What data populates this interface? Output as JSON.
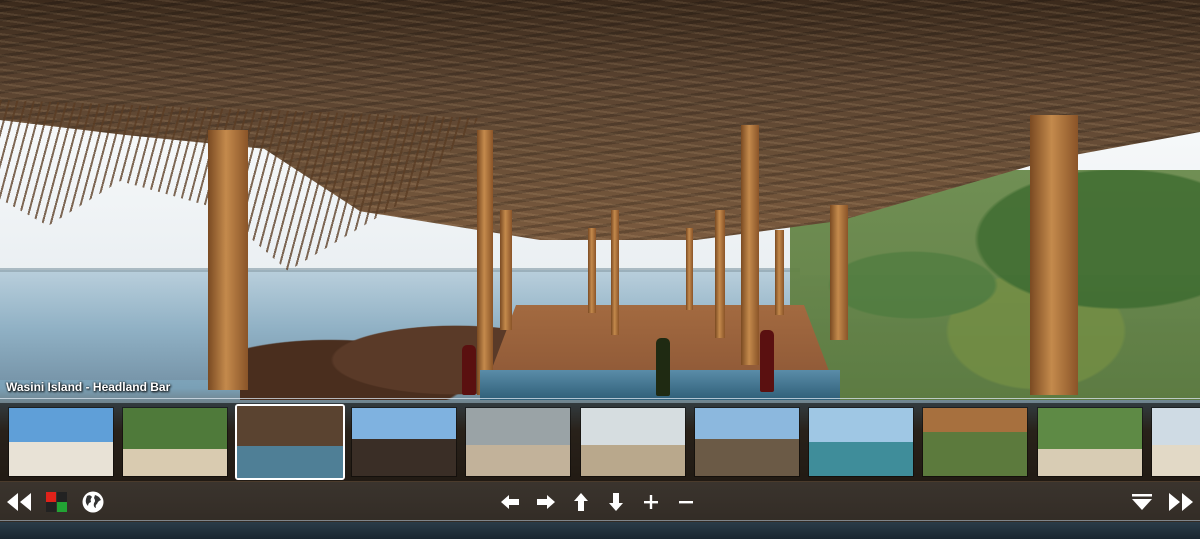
{
  "caption": "Wasini Island - Headland Bar",
  "thumbnails": [
    {
      "sky": "#5f9fd8",
      "ground": "#e8e2d6",
      "split": 0.5
    },
    {
      "sky": "#4f7a3a",
      "ground": "#d9cbb0",
      "split": 0.6
    },
    {
      "sky": "#5a4330",
      "ground": "#4f7f96",
      "split": 0.55,
      "selected": true
    },
    {
      "sky": "#7fb2e0",
      "ground": "#3a2e26",
      "split": 0.45
    },
    {
      "sky": "#9aa3a6",
      "ground": "#c2b29a",
      "split": 0.55
    },
    {
      "sky": "#d6dde0",
      "ground": "#b9a88c",
      "split": 0.55
    },
    {
      "sky": "#8cb8de",
      "ground": "#6b5a46",
      "split": 0.45
    },
    {
      "sky": "#9fc7e4",
      "ground": "#3f8d9a",
      "split": 0.5
    },
    {
      "sky": "#a7703e",
      "ground": "#5c7a3d",
      "split": 0.35
    },
    {
      "sky": "#5e8a45",
      "ground": "#d8ccb4",
      "split": 0.6
    },
    {
      "sky": "#cfdbe4",
      "ground": "#e2d9c6",
      "split": 0.55
    }
  ],
  "controls": {
    "left": [
      {
        "name": "rewind-icon"
      },
      {
        "name": "color-scheme-icon"
      },
      {
        "name": "globe-icon"
      }
    ],
    "center": [
      {
        "name": "arrow-left-icon"
      },
      {
        "name": "arrow-right-icon"
      },
      {
        "name": "arrow-up-icon"
      },
      {
        "name": "arrow-down-icon"
      },
      {
        "name": "zoom-in-icon"
      },
      {
        "name": "zoom-out-icon"
      }
    ],
    "right": [
      {
        "name": "hide-thumbnails-icon"
      },
      {
        "name": "fast-forward-icon"
      }
    ]
  },
  "colors": {
    "accent": "#ffffff",
    "strip": "#000000",
    "icon-red": "#e0221a",
    "icon-green": "#22a334"
  }
}
